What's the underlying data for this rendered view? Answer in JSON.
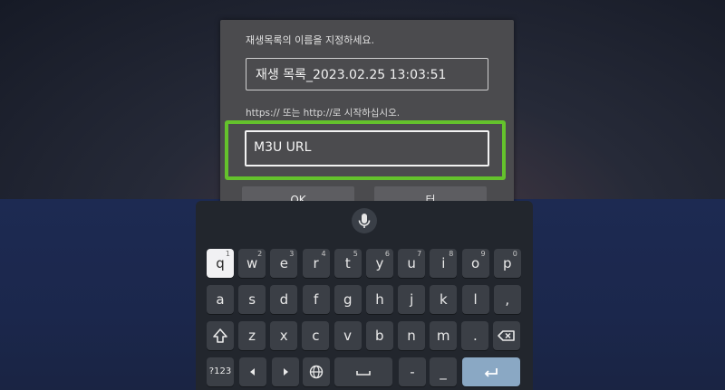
{
  "dialog": {
    "title": "재생목록의 이름을 지정하세요.",
    "name_value": "재생 목록_2023.02.25 13:03:51",
    "hint": "https:// 또는 http://로 시작하십시오.",
    "url_placeholder": "M3U URL",
    "ok_label": "OK",
    "cancel_label": "터"
  },
  "keyboard": {
    "row1": [
      {
        "k": "q",
        "n": "1"
      },
      {
        "k": "w",
        "n": "2"
      },
      {
        "k": "e",
        "n": "3"
      },
      {
        "k": "r",
        "n": "4"
      },
      {
        "k": "t",
        "n": "5"
      },
      {
        "k": "y",
        "n": "6"
      },
      {
        "k": "u",
        "n": "7"
      },
      {
        "k": "i",
        "n": "8"
      },
      {
        "k": "o",
        "n": "9"
      },
      {
        "k": "p",
        "n": "0"
      }
    ],
    "row2": [
      "a",
      "s",
      "d",
      "f",
      "g",
      "h",
      "j",
      "k",
      "l",
      ","
    ],
    "row3": [
      "z",
      "x",
      "c",
      "v",
      "b",
      "n",
      "m",
      "."
    ],
    "symbols_label": "?123",
    "dash1": "-",
    "dash2": "_"
  },
  "colors": {
    "focus_ring": "#64c22c",
    "dialog_bg": "#4b4b4e",
    "keyboard_bg": "#22262d",
    "enter_key": "#8aa8c4"
  }
}
